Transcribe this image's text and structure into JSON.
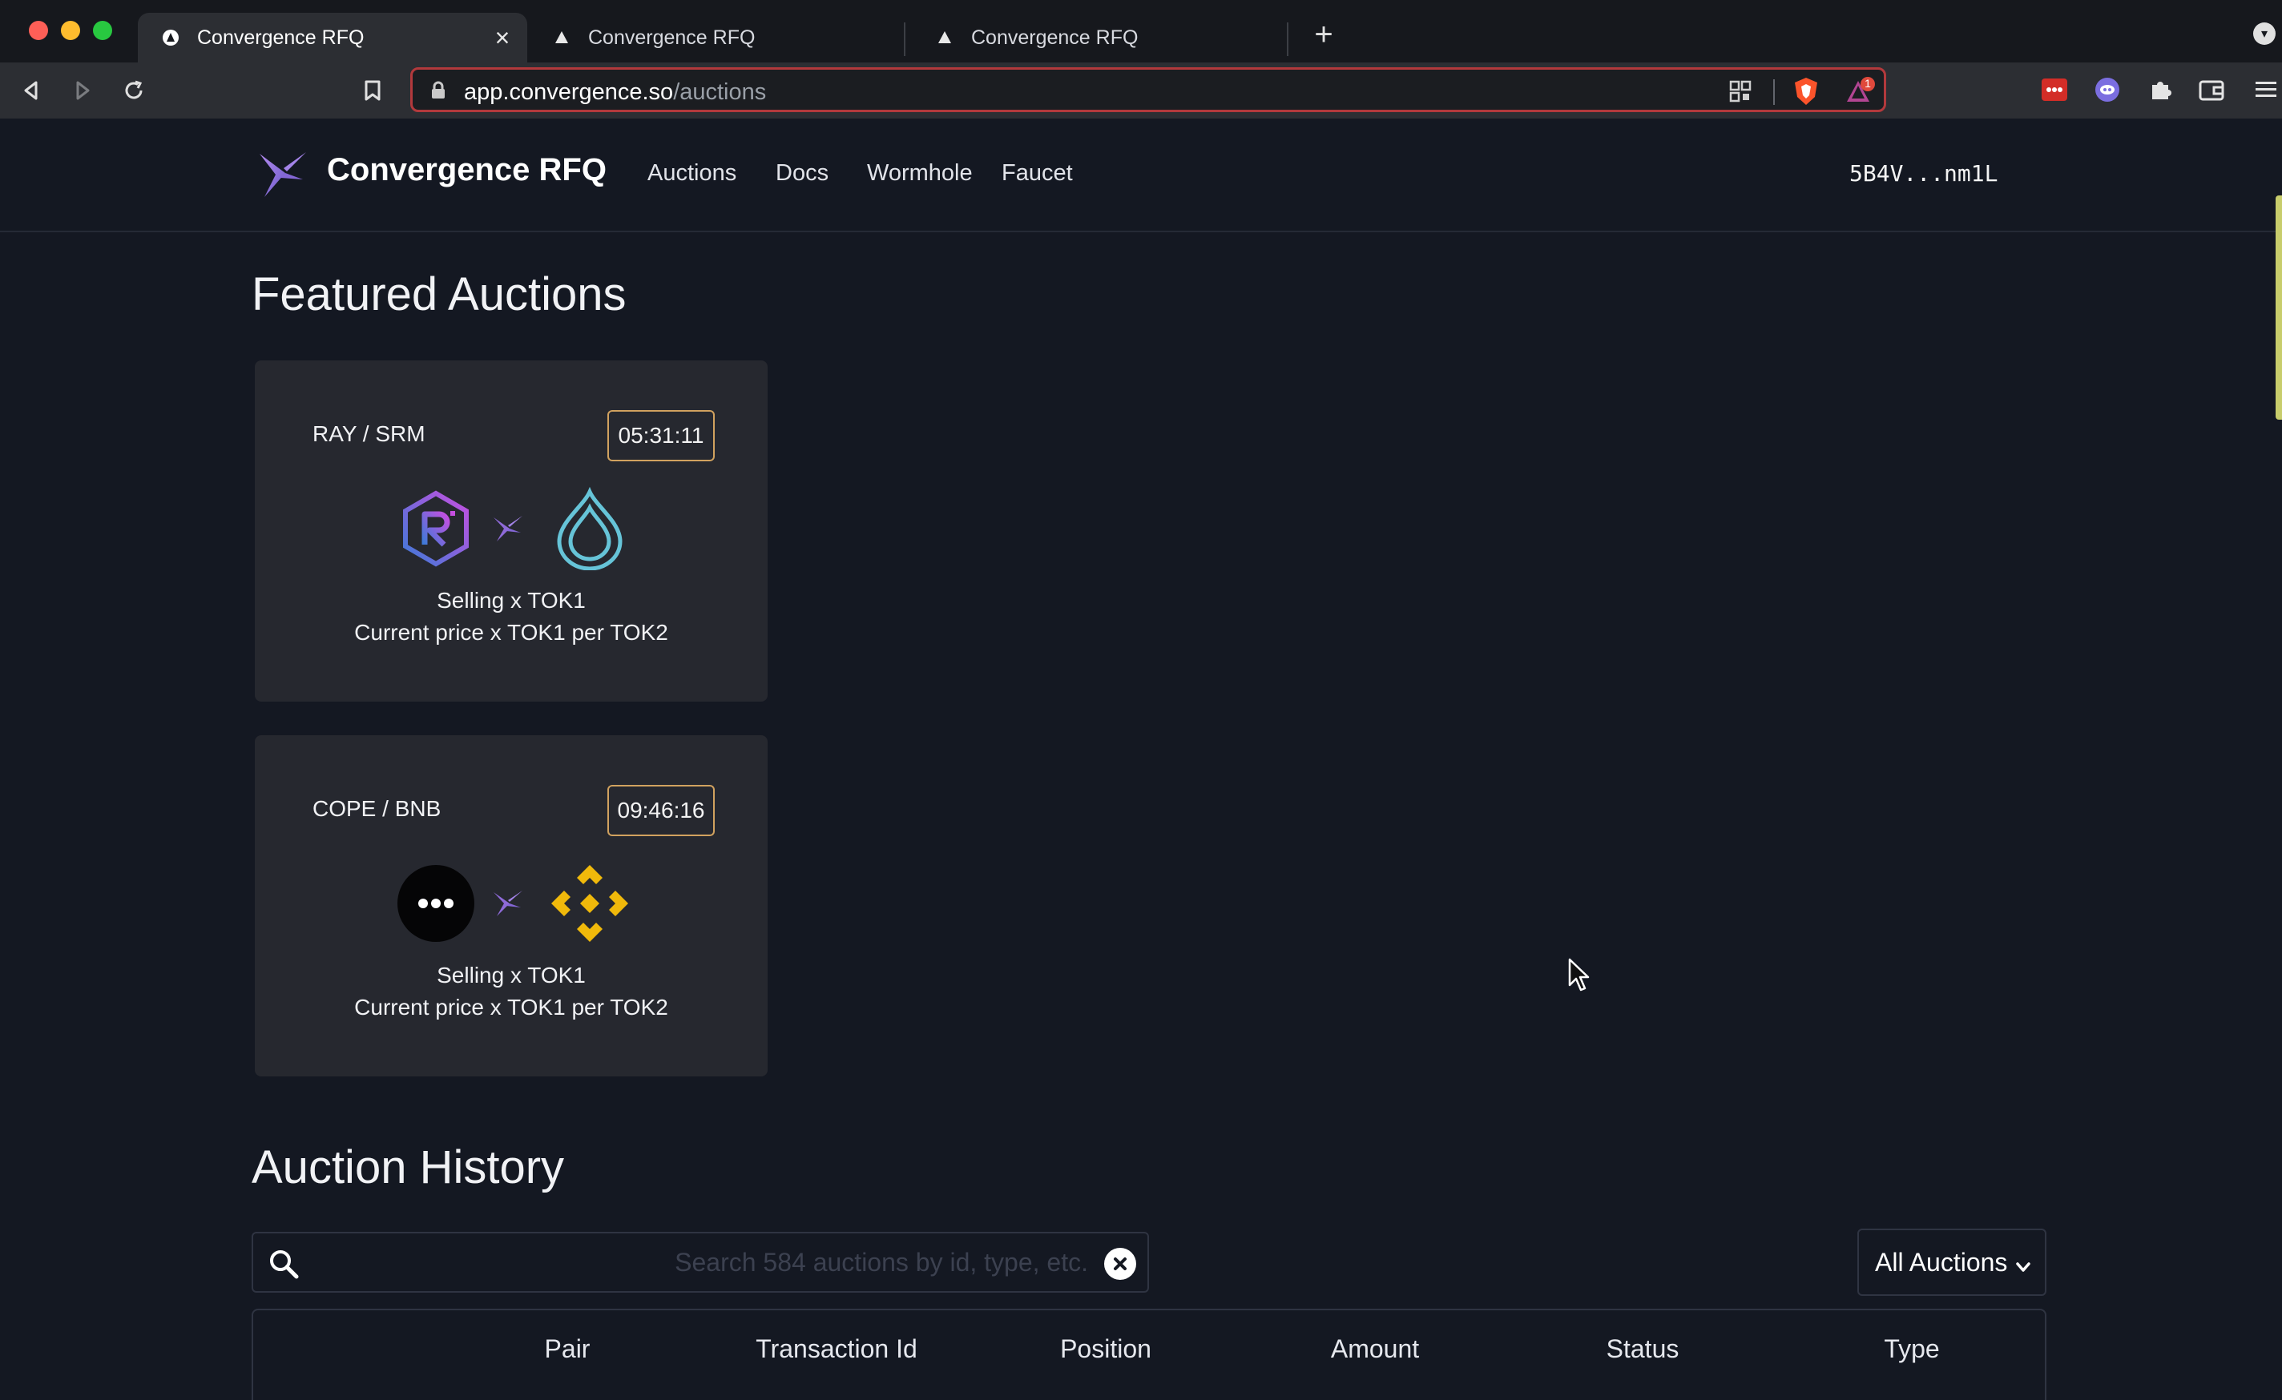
{
  "browser": {
    "tabs": [
      {
        "title": "Convergence RFQ",
        "active": true
      },
      {
        "title": "Convergence RFQ",
        "active": false
      },
      {
        "title": "Convergence RFQ",
        "active": false
      }
    ],
    "url": {
      "host": "app.convergence.so",
      "path": "/auctions"
    },
    "shields_badge": "1"
  },
  "header": {
    "brand": "Convergence RFQ",
    "nav": [
      "Auctions",
      "Docs",
      "Wormhole",
      "Faucet"
    ],
    "wallet": "5B4V...nm1L"
  },
  "featured": {
    "title": "Featured Auctions",
    "cards": [
      {
        "pair": "RAY / SRM",
        "timer": "05:31:11",
        "selling": "Selling x TOK1",
        "price": "Current price x TOK1 per TOK2",
        "icons": [
          "raydium-icon",
          "serum-icon"
        ]
      },
      {
        "pair": "COPE / BNB",
        "timer": "09:46:16",
        "selling": "Selling x TOK1",
        "price": "Current price x TOK1 per TOK2",
        "icons": [
          "cope-icon",
          "bnb-icon"
        ]
      }
    ]
  },
  "history": {
    "title": "Auction History",
    "search_placeholder": "Search 584 auctions by id, type, etc.",
    "filter": "All Auctions",
    "columns": [
      "Pair",
      "Transaction Id",
      "Position",
      "Amount",
      "Status",
      "Type"
    ]
  },
  "colors": {
    "accent": "#8e6ad8",
    "timer_border": "#d1a25f",
    "background": "#141822",
    "card": "#26282f"
  }
}
